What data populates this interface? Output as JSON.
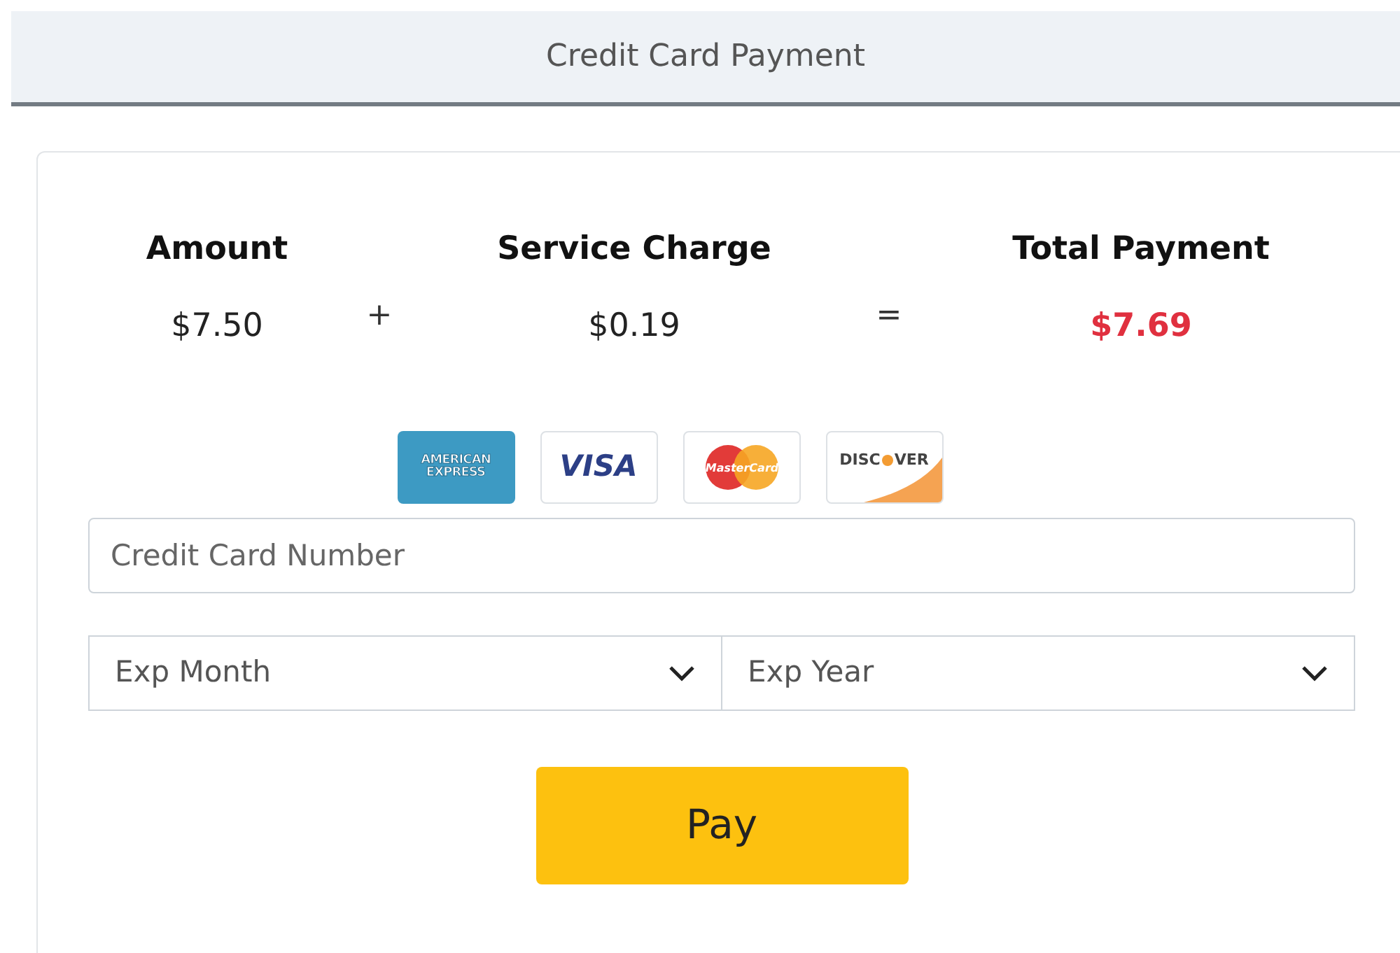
{
  "header": {
    "title": "Credit Card Payment"
  },
  "summary": [
    {
      "kind": "figure",
      "label": "Amount",
      "value": "$7.50",
      "highlight": false
    },
    {
      "kind": "operator",
      "symbol": "+"
    },
    {
      "kind": "figure",
      "label": "Service Charge",
      "value": "$0.19",
      "highlight": false
    },
    {
      "kind": "operator",
      "symbol": "="
    },
    {
      "kind": "figure",
      "label": "Total Payment",
      "value": "$7.69",
      "highlight": true
    }
  ],
  "cards": [
    {
      "kind": "amex",
      "lines": [
        "AMERICAN",
        "EXPRESS"
      ]
    },
    {
      "kind": "visa",
      "lines": [
        "VISA"
      ]
    },
    {
      "kind": "mastercard",
      "lines": [
        "MasterCard"
      ]
    },
    {
      "kind": "discover",
      "lines": [
        "DISC",
        "VER"
      ]
    }
  ],
  "card_number": {
    "placeholder": "Credit Card Number"
  },
  "exp_month": {
    "placeholder": "Exp Month"
  },
  "exp_year": {
    "placeholder": "Exp Year"
  },
  "pay_button": {
    "label": "Pay"
  }
}
